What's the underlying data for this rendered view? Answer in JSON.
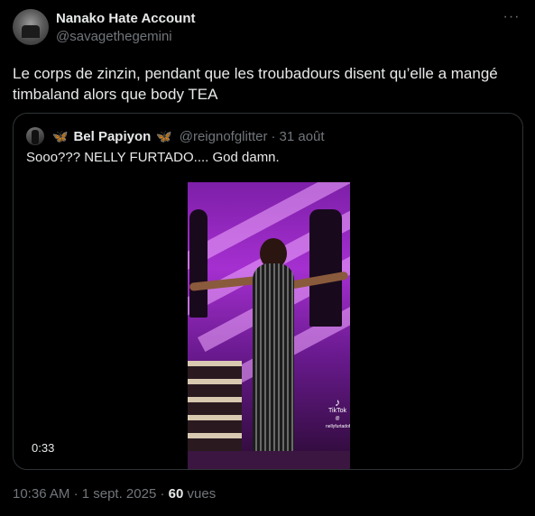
{
  "tweet": {
    "author_name": "Nanako Hate Account",
    "author_handle": "@savagethegemini",
    "more_icon": "more-horizontal-icon",
    "text": "Le corps de zinzin, pendant que les troubadours disent qu’elle a mangé timbaland alors que body TEA"
  },
  "quote": {
    "author_name": "Bel Papiyon",
    "name_prefix_emoji": "🦋",
    "name_suffix_emoji": "🦋",
    "author_handle": "@reignofglitter",
    "separator": "·",
    "date": "31 août",
    "text": "Sooo??? NELLY FURTADO.... God damn.",
    "video": {
      "duration": "0:33",
      "watermark_brand": "TikTok",
      "watermark_handle": "@ nellyfurtadofr"
    }
  },
  "meta": {
    "time": "10:36 AM",
    "date": "1 sept. 2025",
    "separator": "·",
    "views_count": "60",
    "views_label": "vues"
  },
  "colors": {
    "background": "#000000",
    "text_primary": "#e7e9ea",
    "text_secondary": "#71767b",
    "border": "#2f3336"
  }
}
